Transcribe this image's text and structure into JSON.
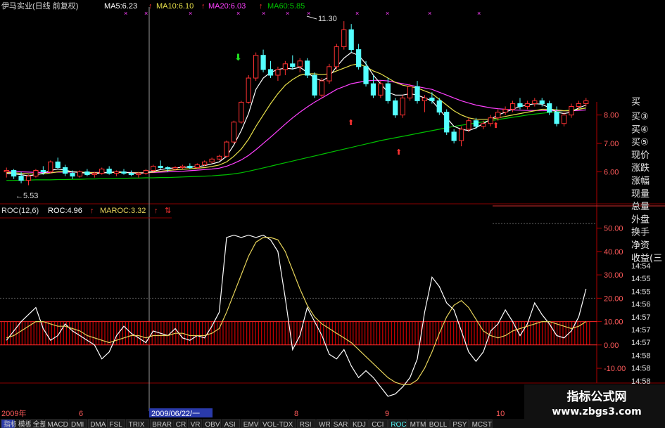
{
  "chart_data": [
    {
      "type": "candlestick",
      "header": {
        "stock_label": "伊马实业(日线 前复权)",
        "ma5_label": "MA5:6.23",
        "ma10_label": "MA10:6.10",
        "ma20_label": "MA20:6.03",
        "ma60_label": "MA60:5.85"
      },
      "annotations": {
        "high_label": "11.30",
        "low_label": "←5.53"
      },
      "y_ticks": [
        "8.00",
        "7.00",
        "6.00"
      ],
      "ylim": [
        5.0,
        11.6
      ],
      "candles": [
        {
          "o": 6.0,
          "h": 6.15,
          "l": 5.8,
          "c": 6.05
        },
        {
          "o": 6.05,
          "h": 6.1,
          "l": 5.75,
          "c": 5.85
        },
        {
          "o": 5.85,
          "h": 6.0,
          "l": 5.6,
          "c": 5.7
        },
        {
          "o": 5.7,
          "h": 5.9,
          "l": 5.53,
          "c": 5.85
        },
        {
          "o": 5.85,
          "h": 6.1,
          "l": 5.8,
          "c": 6.05
        },
        {
          "o": 6.05,
          "h": 6.2,
          "l": 5.9,
          "c": 6.0
        },
        {
          "o": 6.0,
          "h": 6.4,
          "l": 5.95,
          "c": 6.35
        },
        {
          "o": 6.35,
          "h": 6.5,
          "l": 6.1,
          "c": 6.15
        },
        {
          "o": 6.15,
          "h": 6.25,
          "l": 5.85,
          "c": 5.95
        },
        {
          "o": 5.95,
          "h": 6.05,
          "l": 5.75,
          "c": 5.85
        },
        {
          "o": 5.85,
          "h": 6.05,
          "l": 5.8,
          "c": 6.0
        },
        {
          "o": 6.0,
          "h": 6.1,
          "l": 5.85,
          "c": 5.9
        },
        {
          "o": 5.9,
          "h": 6.0,
          "l": 5.8,
          "c": 5.95
        },
        {
          "o": 5.95,
          "h": 6.15,
          "l": 5.9,
          "c": 6.1
        },
        {
          "o": 6.1,
          "h": 6.2,
          "l": 5.9,
          "c": 5.95
        },
        {
          "o": 5.95,
          "h": 6.05,
          "l": 5.85,
          "c": 6.0
        },
        {
          "o": 6.0,
          "h": 6.1,
          "l": 5.9,
          "c": 5.95
        },
        {
          "o": 5.95,
          "h": 6.05,
          "l": 5.85,
          "c": 5.9
        },
        {
          "o": 5.9,
          "h": 6.0,
          "l": 5.8,
          "c": 5.95
        },
        {
          "o": 5.95,
          "h": 6.1,
          "l": 5.9,
          "c": 6.05
        },
        {
          "o": 6.05,
          "h": 6.25,
          "l": 6.0,
          "c": 6.2
        },
        {
          "o": 6.2,
          "h": 6.4,
          "l": 6.1,
          "c": 6.15
        },
        {
          "o": 6.15,
          "h": 6.2,
          "l": 6.0,
          "c": 6.1
        },
        {
          "o": 6.1,
          "h": 6.2,
          "l": 6.05,
          "c": 6.15
        },
        {
          "o": 6.15,
          "h": 6.25,
          "l": 6.1,
          "c": 6.2
        },
        {
          "o": 6.2,
          "h": 6.3,
          "l": 6.1,
          "c": 6.15
        },
        {
          "o": 6.15,
          "h": 6.3,
          "l": 6.1,
          "c": 6.25
        },
        {
          "o": 6.25,
          "h": 6.4,
          "l": 6.2,
          "c": 6.35
        },
        {
          "o": 6.35,
          "h": 6.5,
          "l": 6.3,
          "c": 6.45
        },
        {
          "o": 6.45,
          "h": 6.6,
          "l": 6.4,
          "c": 6.55
        },
        {
          "o": 6.55,
          "h": 7.1,
          "l": 6.5,
          "c": 7.05
        },
        {
          "o": 7.05,
          "h": 7.8,
          "l": 7.0,
          "c": 7.75
        },
        {
          "o": 7.75,
          "h": 8.5,
          "l": 7.7,
          "c": 8.45
        },
        {
          "o": 8.45,
          "h": 9.4,
          "l": 8.4,
          "c": 9.3
        },
        {
          "o": 9.3,
          "h": 10.2,
          "l": 9.2,
          "c": 10.1
        },
        {
          "o": 10.1,
          "h": 10.3,
          "l": 9.5,
          "c": 9.6
        },
        {
          "o": 9.6,
          "h": 9.9,
          "l": 9.3,
          "c": 9.4
        },
        {
          "o": 9.4,
          "h": 9.7,
          "l": 9.2,
          "c": 9.6
        },
        {
          "o": 9.6,
          "h": 9.9,
          "l": 9.4,
          "c": 9.8
        },
        {
          "o": 9.8,
          "h": 10.1,
          "l": 9.6,
          "c": 9.7
        },
        {
          "o": 9.7,
          "h": 10.0,
          "l": 9.5,
          "c": 9.9
        },
        {
          "o": 9.9,
          "h": 10.0,
          "l": 9.3,
          "c": 9.4
        },
        {
          "o": 9.4,
          "h": 9.5,
          "l": 8.6,
          "c": 8.7
        },
        {
          "o": 8.7,
          "h": 9.3,
          "l": 8.6,
          "c": 9.2
        },
        {
          "o": 9.2,
          "h": 9.8,
          "l": 9.1,
          "c": 9.7
        },
        {
          "o": 9.7,
          "h": 10.5,
          "l": 9.6,
          "c": 10.4
        },
        {
          "o": 10.4,
          "h": 11.3,
          "l": 10.3,
          "c": 11.0
        },
        {
          "o": 11.0,
          "h": 11.2,
          "l": 10.2,
          "c": 10.3
        },
        {
          "o": 10.3,
          "h": 10.5,
          "l": 9.6,
          "c": 9.7
        },
        {
          "o": 9.7,
          "h": 9.9,
          "l": 9.0,
          "c": 9.1
        },
        {
          "o": 9.1,
          "h": 9.4,
          "l": 8.6,
          "c": 8.7
        },
        {
          "o": 8.7,
          "h": 9.2,
          "l": 8.6,
          "c": 9.1
        },
        {
          "o": 9.1,
          "h": 9.3,
          "l": 8.4,
          "c": 8.5
        },
        {
          "o": 8.5,
          "h": 8.6,
          "l": 7.9,
          "c": 8.0
        },
        {
          "o": 8.0,
          "h": 8.7,
          "l": 7.9,
          "c": 8.6
        },
        {
          "o": 8.6,
          "h": 9.1,
          "l": 8.5,
          "c": 9.0
        },
        {
          "o": 9.0,
          "h": 9.2,
          "l": 8.4,
          "c": 8.5
        },
        {
          "o": 8.5,
          "h": 8.7,
          "l": 8.1,
          "c": 8.6
        },
        {
          "o": 8.6,
          "h": 8.8,
          "l": 8.4,
          "c": 8.5
        },
        {
          "o": 8.5,
          "h": 8.6,
          "l": 8.0,
          "c": 8.1
        },
        {
          "o": 8.1,
          "h": 8.2,
          "l": 7.3,
          "c": 7.4
        },
        {
          "o": 7.4,
          "h": 7.5,
          "l": 7.0,
          "c": 7.1
        },
        {
          "o": 7.1,
          "h": 7.6,
          "l": 6.9,
          "c": 7.5
        },
        {
          "o": 7.5,
          "h": 7.9,
          "l": 7.4,
          "c": 7.8
        },
        {
          "o": 7.8,
          "h": 7.9,
          "l": 7.5,
          "c": 7.6
        },
        {
          "o": 7.6,
          "h": 7.8,
          "l": 7.5,
          "c": 7.7
        },
        {
          "o": 7.7,
          "h": 8.0,
          "l": 7.6,
          "c": 7.9
        },
        {
          "o": 7.9,
          "h": 8.2,
          "l": 7.8,
          "c": 8.1
        },
        {
          "o": 8.1,
          "h": 8.3,
          "l": 8.0,
          "c": 8.2
        },
        {
          "o": 8.2,
          "h": 8.5,
          "l": 8.1,
          "c": 8.4
        },
        {
          "o": 8.4,
          "h": 8.6,
          "l": 8.2,
          "c": 8.3
        },
        {
          "o": 8.3,
          "h": 8.5,
          "l": 8.2,
          "c": 8.4
        },
        {
          "o": 8.4,
          "h": 8.6,
          "l": 8.3,
          "c": 8.5
        },
        {
          "o": 8.5,
          "h": 8.6,
          "l": 8.3,
          "c": 8.4
        },
        {
          "o": 8.4,
          "h": 8.5,
          "l": 8.0,
          "c": 8.1
        },
        {
          "o": 8.1,
          "h": 8.3,
          "l": 7.6,
          "c": 7.7
        },
        {
          "o": 7.7,
          "h": 8.1,
          "l": 7.6,
          "c": 8.0
        },
        {
          "o": 8.0,
          "h": 8.4,
          "l": 7.9,
          "c": 8.3
        },
        {
          "o": 8.3,
          "h": 8.5,
          "l": 8.2,
          "c": 8.4
        },
        {
          "o": 8.4,
          "h": 8.6,
          "l": 8.3,
          "c": 8.5
        }
      ],
      "ma5": [
        5.95,
        5.93,
        5.9,
        5.86,
        5.9,
        5.95,
        6.05,
        6.1,
        6.06,
        6.0,
        5.98,
        5.95,
        5.94,
        5.96,
        5.98,
        6.0,
        5.99,
        5.96,
        5.95,
        5.97,
        6.02,
        6.08,
        6.12,
        6.14,
        6.16,
        6.17,
        6.18,
        6.22,
        6.28,
        6.35,
        6.55,
        6.95,
        7.45,
        8.05,
        8.9,
        9.3,
        9.5,
        9.6,
        9.65,
        9.62,
        9.68,
        9.5,
        9.3,
        9.2,
        9.35,
        9.7,
        10.0,
        10.2,
        10.1,
        9.8,
        9.4,
        9.1,
        8.8,
        8.7,
        8.7,
        8.75,
        8.7,
        8.6,
        8.5,
        8.2,
        7.9,
        7.6,
        7.5,
        7.45,
        7.55,
        7.7,
        7.85,
        8.0,
        8.1,
        8.2,
        8.3,
        8.35,
        8.4,
        8.38,
        8.25,
        8.1,
        8.05,
        8.1,
        8.25,
        8.35
      ],
      "ma10": [
        5.98,
        5.97,
        5.95,
        5.93,
        5.92,
        5.93,
        5.96,
        6.0,
        6.01,
        6.0,
        5.99,
        5.98,
        5.97,
        5.97,
        5.98,
        5.98,
        5.98,
        5.97,
        5.97,
        5.97,
        5.99,
        6.02,
        6.05,
        6.07,
        6.09,
        6.11,
        6.13,
        6.15,
        6.19,
        6.24,
        6.35,
        6.55,
        6.8,
        7.15,
        7.6,
        8.0,
        8.4,
        8.75,
        9.05,
        9.25,
        9.4,
        9.45,
        9.45,
        9.42,
        9.45,
        9.55,
        9.65,
        9.75,
        9.8,
        9.7,
        9.55,
        9.45,
        9.3,
        9.15,
        9.05,
        9.0,
        8.95,
        8.85,
        8.75,
        8.55,
        8.35,
        8.15,
        8.0,
        7.9,
        7.85,
        7.85,
        7.85,
        7.9,
        7.95,
        8.0,
        8.05,
        8.1,
        8.15,
        8.2,
        8.2,
        8.18,
        8.15,
        8.15,
        8.2,
        8.25
      ],
      "ma20": [
        6.02,
        6.01,
        6.0,
        5.99,
        5.98,
        5.98,
        5.98,
        5.99,
        5.99,
        5.99,
        5.99,
        5.98,
        5.98,
        5.98,
        5.98,
        5.98,
        5.98,
        5.98,
        5.97,
        5.97,
        5.98,
        5.99,
        6.0,
        6.01,
        6.02,
        6.04,
        6.06,
        6.08,
        6.1,
        6.13,
        6.2,
        6.3,
        6.42,
        6.58,
        6.78,
        7.0,
        7.22,
        7.45,
        7.68,
        7.9,
        8.1,
        8.28,
        8.45,
        8.6,
        8.75,
        8.9,
        9.0,
        9.1,
        9.15,
        9.2,
        9.22,
        9.22,
        9.2,
        9.15,
        9.1,
        9.05,
        9.0,
        8.95,
        8.9,
        8.8,
        8.7,
        8.6,
        8.5,
        8.42,
        8.35,
        8.3,
        8.25,
        8.22,
        8.2,
        8.18,
        8.17,
        8.16,
        8.16,
        8.16,
        8.15,
        8.15,
        8.15,
        8.15,
        8.16,
        8.18
      ],
      "ma60": [
        5.7,
        5.7,
        5.71,
        5.71,
        5.72,
        5.72,
        5.72,
        5.73,
        5.73,
        5.74,
        5.74,
        5.75,
        5.75,
        5.76,
        5.76,
        5.77,
        5.77,
        5.78,
        5.78,
        5.79,
        5.79,
        5.8,
        5.8,
        5.81,
        5.82,
        5.83,
        5.84,
        5.85,
        5.86,
        5.88,
        5.9,
        5.93,
        5.97,
        6.02,
        6.08,
        6.14,
        6.2,
        6.26,
        6.32,
        6.38,
        6.44,
        6.5,
        6.56,
        6.62,
        6.68,
        6.74,
        6.8,
        6.86,
        6.92,
        6.98,
        7.04,
        7.1,
        7.15,
        7.2,
        7.25,
        7.3,
        7.35,
        7.4,
        7.45,
        7.5,
        7.55,
        7.6,
        7.64,
        7.68,
        7.72,
        7.76,
        7.8,
        7.84,
        7.88,
        7.92,
        7.96,
        8.0,
        8.03,
        8.06,
        8.09,
        8.12,
        8.15,
        8.18,
        8.21,
        8.24
      ]
    },
    {
      "type": "line",
      "header": {
        "name_label": "ROC(12,6)",
        "roc_label": "ROC:4.96",
        "maroc_label": "MAROC:3.32"
      },
      "y_ticks": [
        "50.00",
        "40.00",
        "30.00",
        "20.00",
        "10.00",
        "0.00",
        "-10.00"
      ],
      "ylim": [
        -13,
        52
      ],
      "band": [
        0,
        10
      ],
      "series": [
        {
          "key": "roc",
          "values": [
            2,
            6,
            10,
            13,
            16,
            7,
            2,
            4,
            9,
            6,
            4,
            2,
            0,
            -6,
            -3,
            4,
            8,
            5,
            3,
            1,
            6,
            5,
            4,
            7,
            3,
            2,
            4,
            3,
            8,
            14,
            46,
            47,
            46,
            47,
            46,
            47,
            45,
            40,
            20,
            -2,
            4,
            16,
            10,
            4,
            -4,
            -6,
            -2,
            -9,
            -14,
            -11,
            -14,
            -18,
            -22,
            -21,
            -18,
            -14,
            -6,
            14,
            29,
            25,
            18,
            15,
            6,
            -3,
            -7,
            -3,
            6,
            9,
            15,
            10,
            4,
            9,
            18,
            13,
            9,
            4,
            3,
            6,
            12,
            24
          ]
        },
        {
          "key": "maroc",
          "values": [
            3,
            4,
            6,
            8,
            10,
            10,
            9,
            8,
            8,
            7,
            6,
            4,
            3,
            2,
            1,
            2,
            3,
            4,
            4,
            3,
            4,
            4,
            4,
            5,
            5,
            4,
            4,
            4,
            5,
            7,
            14,
            22,
            30,
            38,
            44,
            46,
            46,
            45,
            40,
            32,
            24,
            17,
            12,
            9,
            7,
            5,
            3,
            1,
            -2,
            -5,
            -8,
            -11,
            -14,
            -16,
            -17,
            -17,
            -15,
            -10,
            -3,
            5,
            12,
            17,
            19,
            16,
            11,
            6,
            4,
            3,
            4,
            6,
            7,
            8,
            9,
            10,
            10,
            9,
            8,
            7,
            8,
            10
          ]
        }
      ]
    }
  ],
  "quote_panel": {
    "labels": [
      "买③",
      "买④",
      "买⑤",
      "现价",
      "涨跌",
      "涨幅",
      "现量",
      "总量",
      "外盘",
      "换手",
      "净资",
      "收益(三"
    ],
    "times": [
      "14:54",
      "14:55",
      "14:55",
      "14:56",
      "14:57",
      "14:57",
      "14:57",
      "14:58",
      "14:58",
      "14:58",
      "14:58"
    ],
    "top_label": "买"
  },
  "date_axis": [
    "2009年",
    "6",
    "2009/06/22/一",
    "8",
    "9",
    "10"
  ],
  "tabs": [
    "指标",
    "模板",
    "全部",
    "MACD",
    "DMI",
    "DMA",
    "FSL",
    "TRIX",
    "BRAR",
    "CR",
    "VR",
    "OBV",
    "ASI",
    "EMV",
    "VOL-TDX",
    "RSI",
    "WR",
    "SAR",
    "KDJ",
    "CCI",
    "ROC",
    "MTM",
    "BOLL",
    "PSY",
    "MCST"
  ],
  "active_tab": "ROC",
  "watermark": {
    "title": "指标公式网",
    "url": "www.zbgs3.com"
  },
  "colors": {
    "up": "#ff3232",
    "down": "#54ffff",
    "ma5": "#ffffff",
    "ma10": "#e8e04a",
    "ma20": "#ff40ff",
    "ma60": "#00c000",
    "roc": "#ffffff",
    "maroc": "#e6d35a",
    "axis": "#b00000",
    "band": "#c00000"
  }
}
